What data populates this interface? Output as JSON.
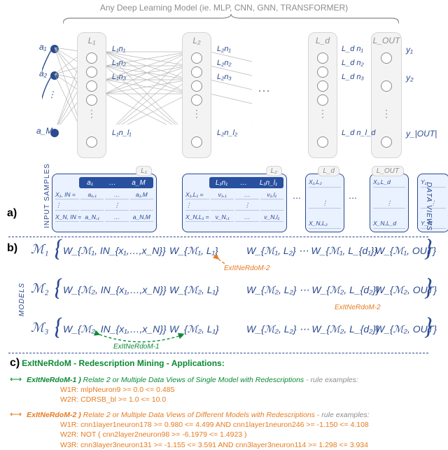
{
  "top_title": "Any Deep Learning Model (ie. MLP, CNN, GNN, TRANSFORMER)",
  "layers": {
    "L1": "L₁",
    "L2": "L₂",
    "Ld": "L_d",
    "LOUT": "L_OUT"
  },
  "neuron_labels": {
    "L1": [
      "L₁n₁",
      "L₁n₂",
      "L₁n₃",
      "L₁n_l₁"
    ],
    "L2": [
      "L₂n₁",
      "L₂n₂",
      "L₂n₃",
      "L₂n_l₂"
    ],
    "Ld": [
      "L_d n₁",
      "L_d n₂",
      "L_d n₃",
      "L_d n_l_d"
    ]
  },
  "inputs": [
    "a₁",
    "a₂",
    "a_M"
  ],
  "outputs": [
    "y₁",
    "y₂",
    "y_|OUT|"
  ],
  "panel_a": {
    "vert_label": "INPUT SAMPLES",
    "tag": "a)",
    "tables": {
      "in": {
        "cap": "L₁",
        "hdr": [
          "a₁",
          "…",
          "a_M"
        ],
        "rows": [
          [
            "X₁, IN =",
            "a₁,₁",
            "…",
            "a₁,M"
          ],
          [
            "⋮",
            "",
            "⋮",
            ""
          ],
          [
            "X_N, IN =",
            "a_N,₁",
            "…",
            "a_N,M"
          ]
        ]
      },
      "l1": {
        "cap": "L₂",
        "hdr": [
          "L₁n₁",
          "…",
          "L₁n_l₁"
        ],
        "rows": [
          [
            "X₁,L₁ =",
            "v₁,₁",
            "…",
            "v₁,l₁"
          ],
          [
            "⋮",
            "",
            "⋮",
            ""
          ],
          [
            "X_N,L₁ =",
            "v_N,₁",
            "…",
            "v_N,l₁"
          ]
        ]
      },
      "l2": {
        "cap": "L_d",
        "rows": [
          "X₁,L₂",
          "⋮",
          "X_N,L₂"
        ]
      },
      "ld": {
        "cap": "L_OUT",
        "rows": [
          "X₁,L_d",
          "⋮",
          "X_N,L_d"
        ]
      },
      "out": {
        "cap": "",
        "rows": [
          "Y₁",
          "⋮",
          "Y_N"
        ]
      }
    }
  },
  "panel_b": {
    "tag": "b)",
    "left_label": "MODELS",
    "right_label": "DATA VIEWS",
    "rows": [
      {
        "M": "ℳ₁",
        "W": [
          "W_{ℳ₁, IN_{x₁,…,x_N}}",
          "W_{ℳ₁, L₁}",
          "W_{ℳ₁, L₂}  ⋯  W_{ℳ₁, L_{d₁}}",
          "W_{ℳ₁, OUT}"
        ]
      },
      {
        "M": "ℳ₂",
        "W": [
          "W_{ℳ₂, IN_{x₁,…,x_N}}",
          "W_{ℳ₂, L₁}",
          "W_{ℳ₂, L₂}  ⋯  W_{ℳ₂, L_{d₂}}",
          "W_{ℳ₂, OUT}"
        ]
      },
      {
        "M": "ℳ₃",
        "W": [
          "W_{ℳ₂, IN_{x₁,…,x_N}}",
          "W_{ℳ₂, L₁}",
          "W_{ℳ₂, L₂}  ⋯  W_{ℳ₂, L_{d₂}}",
          "W_{ℳ₂, OUT}"
        ]
      }
    ],
    "annots": {
      "orange": "ExItNeRdoM-2",
      "green": "ExItNeRdoM-1"
    }
  },
  "panel_c": {
    "tag": "c)",
    "title": "ExItNeRdoM - Redescription Mining - Applications:",
    "block1": {
      "head_bold": "ExItNeRdoM-1 ) ",
      "head_rest": "Relate 2 or Multiple Data Views of Single Model with Redescriptions",
      "note": " - rule examples:",
      "rules": [
        "W1R: mlpNeuron9 >= 0.0 <= 0.485",
        "W2R: CDRSB_bl >= 1.0 <= 10.0"
      ]
    },
    "block2": {
      "head_bold": "ExItNeRdoM-2 ) ",
      "head_rest": "Relate 2 or Multiple Data Views of Different Models with Redescriptions",
      "note": " - rule examples:",
      "rules": [
        "W1R: cnn1layer1neuron178 >= 0.980 <= 4.499 AND cnn1layer1neuron246 >= -1.150 <= 4.108",
        "W2R: NOT ( cnn2layer2neuron98 >= -6.1979 <= 1.4923 )",
        "W3R: cnn3layer3neuron131 >= -1.155 <= 3.591 AND cnn3layer3neuron114 >= 1.298 <= 3.934"
      ]
    }
  }
}
